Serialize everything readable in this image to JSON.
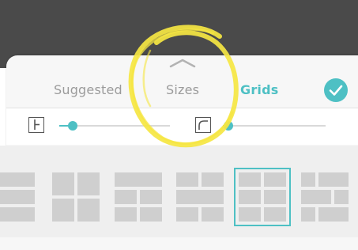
{
  "tabs": {
    "suggested": "Suggested",
    "sizes": "Sizes",
    "grids": "Grids",
    "active": "grids"
  },
  "controls": {
    "spacing_icon": "grid-spacing-icon",
    "spacing_value": 0.12,
    "corner_icon": "corner-radius-icon",
    "corner_value": 0.05
  },
  "done_icon": "checkmark-icon",
  "grid_options": [
    {
      "layout": "three-rows",
      "selected": false
    },
    {
      "layout": "2x2",
      "selected": false
    },
    {
      "layout": "wide-top-two-bottom",
      "selected": false
    },
    {
      "layout": "mixed-rows",
      "selected": false
    },
    {
      "layout": "2x3",
      "selected": true
    },
    {
      "layout": "3x3-mixed",
      "selected": false
    }
  ],
  "colors": {
    "accent": "#4ec0c4",
    "header_dark": "#4a4a4a",
    "annotation": "#f5e642"
  }
}
